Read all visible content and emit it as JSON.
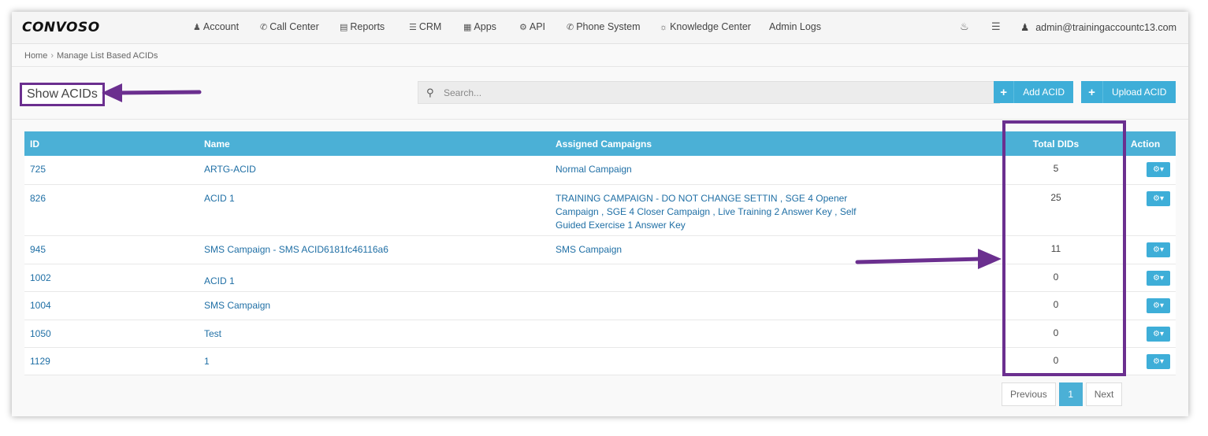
{
  "navbar": {
    "logo": "CONVOSO",
    "items": [
      {
        "icon": "user-icon",
        "glyph": "👤",
        "label": "Account"
      },
      {
        "icon": "phone-icon",
        "glyph": "✆",
        "label": "Call Center"
      },
      {
        "icon": "bar-chart-icon",
        "glyph": "▥",
        "label": "Reports"
      },
      {
        "icon": "list-icon",
        "glyph": "☰",
        "label": "CRM"
      },
      {
        "icon": "grid-icon",
        "glyph": "▦",
        "label": "Apps"
      },
      {
        "icon": "cog-icon",
        "glyph": "⚙",
        "label": "API"
      },
      {
        "icon": "phone-icon",
        "glyph": "✆",
        "label": "Phone System"
      },
      {
        "icon": "lightbulb-icon",
        "glyph": "💡",
        "label": "Knowledge Center"
      },
      {
        "icon": "",
        "glyph": "",
        "label": "Admin Logs"
      }
    ],
    "user": "admin@trainingaccountc13.com"
  },
  "breadcrumb": {
    "home": "Home",
    "sep": "›",
    "current": "Manage List Based ACIDs"
  },
  "page": {
    "title": "Show ACIDs",
    "search_placeholder": "Search...",
    "add_button": "Add ACID",
    "upload_button": "Upload ACID"
  },
  "table": {
    "columns": {
      "id": "ID",
      "name": "Name",
      "campaigns": "Assigned Campaigns",
      "total": "Total DIDs",
      "action": "Action"
    },
    "rows": [
      {
        "id": "725",
        "name": "ARTG-ACID",
        "campaigns": "Normal Campaign",
        "total": "5"
      },
      {
        "id": "826",
        "name": "ACID 1",
        "campaigns": "TRAINING CAMPAIGN - DO NOT CHANGE SETTIN , SGE 4 Opener Campaign , SGE 4 Closer Campaign , Live Training 2 Answer Key , Self Guided Exercise 1 Answer Key",
        "total": "25"
      },
      {
        "id": "945",
        "name": "SMS Campaign - SMS ACID6181fc46116a6",
        "campaigns": "SMS Campaign",
        "total": "11"
      },
      {
        "id": "1002",
        "name": "ACID 1",
        "campaigns": "",
        "total": "0"
      },
      {
        "id": "1004",
        "name": "SMS Campaign",
        "campaigns": "",
        "total": "0"
      },
      {
        "id": "1050",
        "name": "Test",
        "campaigns": "",
        "total": "0"
      },
      {
        "id": "1129",
        "name": "1",
        "campaigns": "",
        "total": "0"
      }
    ]
  },
  "pagination": {
    "previous": "Previous",
    "current": "1",
    "next": "Next"
  },
  "colors": {
    "accent": "#4bb0d6",
    "annotation": "#6b2f8f"
  }
}
